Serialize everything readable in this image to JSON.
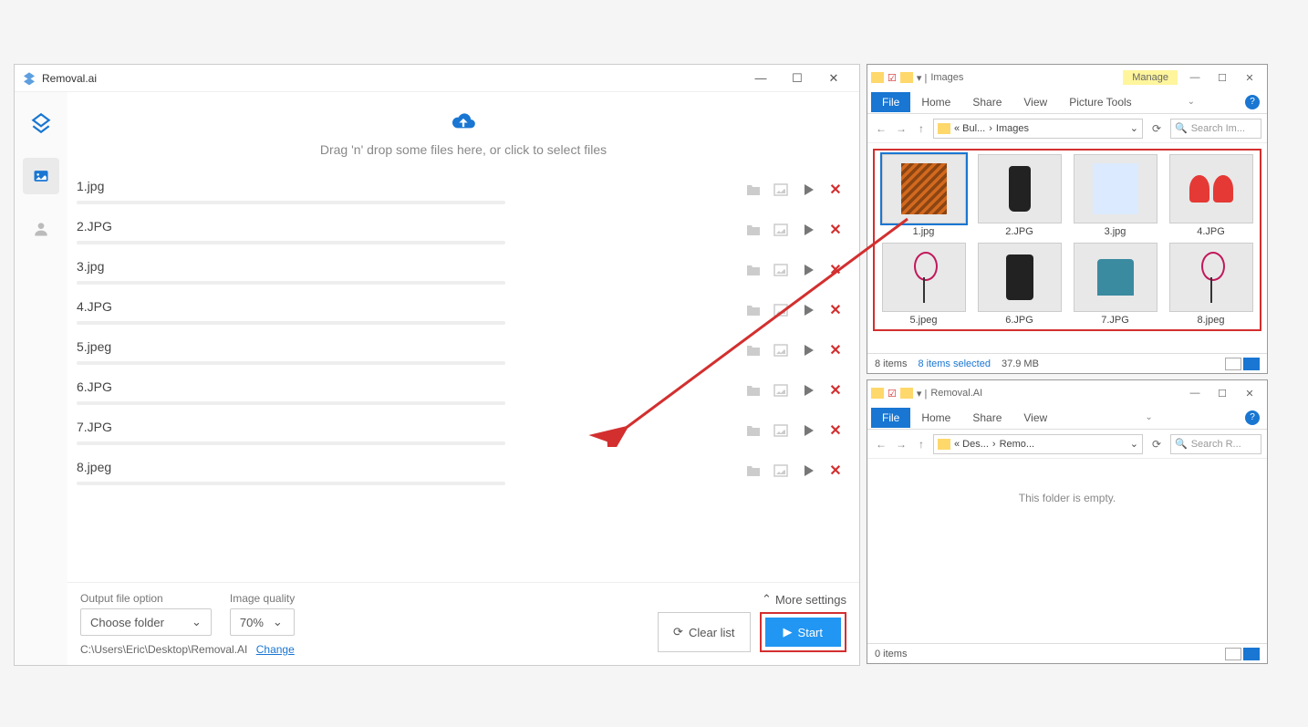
{
  "app": {
    "title": "Removal.ai",
    "dropText": "Drag 'n' drop some files here, or click to select files",
    "files": [
      "1.jpg",
      "2.JPG",
      "3.jpg",
      "4.JPG",
      "5.jpeg",
      "6.JPG",
      "7.JPG",
      "8.jpeg"
    ],
    "footer": {
      "outputLabel": "Output file option",
      "outputValue": "Choose folder",
      "qualityLabel": "Image quality",
      "qualityValue": "70%",
      "moreSettings": "More settings",
      "path": "C:\\Users\\Eric\\Desktop\\Removal.AI",
      "change": "Change",
      "clearList": "Clear list",
      "start": "Start"
    }
  },
  "explorerTop": {
    "title": "Images",
    "manage": "Manage",
    "tabs": {
      "file": "File",
      "home": "Home",
      "share": "Share",
      "view": "View",
      "picture": "Picture Tools"
    },
    "breadcrumb": {
      "p1": "« Bul...",
      "p2": "Images"
    },
    "searchPlaceholder": "Search Im...",
    "items": [
      "1.jpg",
      "2.JPG",
      "3.jpg",
      "4.JPG",
      "5.jpeg",
      "6.JPG",
      "7.JPG",
      "8.jpeg"
    ],
    "status": {
      "count": "8 items",
      "selected": "8 items selected",
      "size": "37.9 MB"
    }
  },
  "explorerBottom": {
    "title": "Removal.AI",
    "tabs": {
      "file": "File",
      "home": "Home",
      "share": "Share",
      "view": "View"
    },
    "breadcrumb": {
      "p1": "« Des...",
      "p2": "Remo..."
    },
    "searchPlaceholder": "Search R...",
    "empty": "This folder is empty.",
    "status": {
      "count": "0 items"
    }
  }
}
